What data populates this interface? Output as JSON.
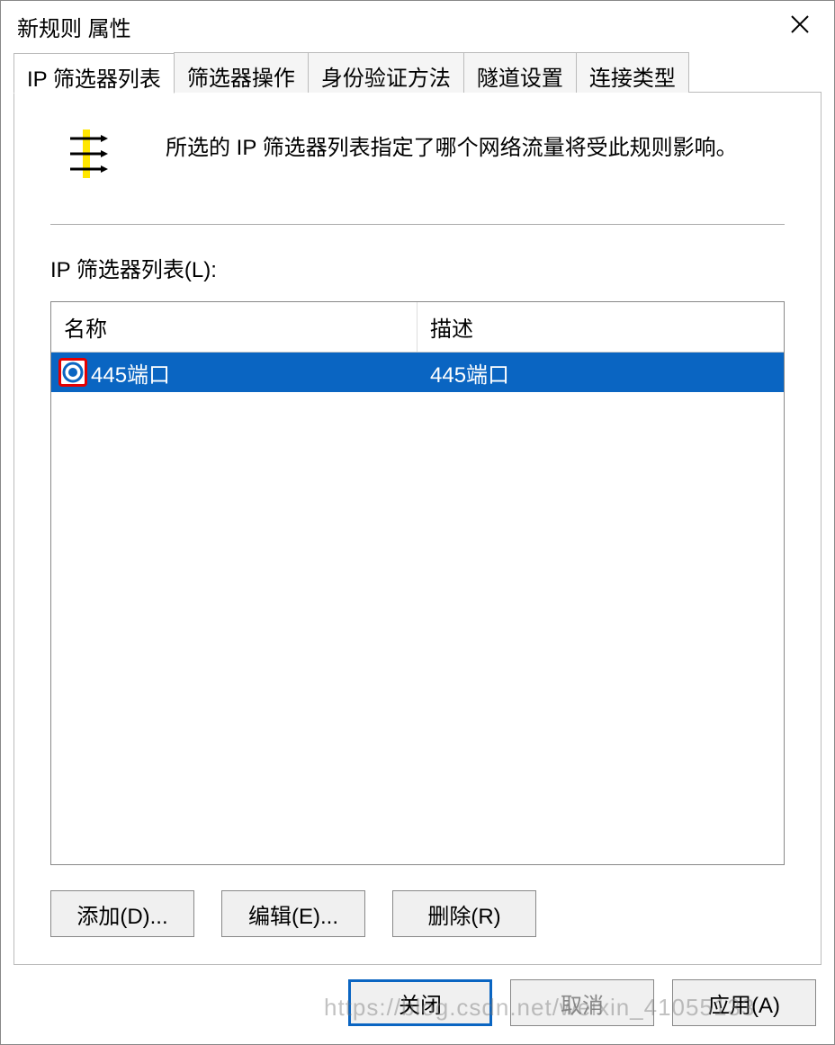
{
  "dialog": {
    "title": "新规则 属性"
  },
  "tabs": [
    {
      "label": "IP 筛选器列表",
      "active": true
    },
    {
      "label": "筛选器操作"
    },
    {
      "label": "身份验证方法"
    },
    {
      "label": "隧道设置"
    },
    {
      "label": "连接类型"
    }
  ],
  "panel": {
    "description": "所选的 IP 筛选器列表指定了哪个网络流量将受此规则影响。",
    "list_label": "IP 筛选器列表(L):"
  },
  "columns": {
    "name": "名称",
    "desc": "描述"
  },
  "rows": [
    {
      "name": "445端口",
      "desc": "445端口",
      "selected": true,
      "checked": true
    }
  ],
  "buttons": {
    "add": "添加(D)...",
    "edit": "编辑(E)...",
    "remove": "删除(R)"
  },
  "dialog_buttons": {
    "close": "关闭",
    "cancel": "取消",
    "apply": "应用(A)"
  },
  "watermark": "https://blog.csdn.net/weixin_41055133"
}
